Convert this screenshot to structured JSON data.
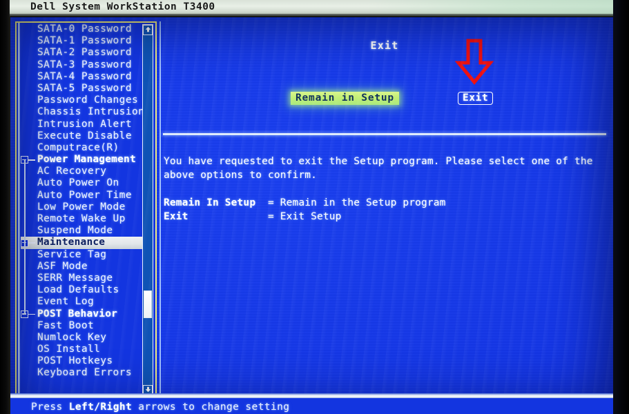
{
  "window": {
    "title": "Dell System WorkStation T3400"
  },
  "sidebar": {
    "items": [
      {
        "label": "SATA-0 Password",
        "type": "item"
      },
      {
        "label": "SATA-1 Password",
        "type": "item"
      },
      {
        "label": "SATA-2 Password",
        "type": "item"
      },
      {
        "label": "SATA-3 Password",
        "type": "item"
      },
      {
        "label": "SATA-4 Password",
        "type": "item"
      },
      {
        "label": "SATA-5 Password",
        "type": "item"
      },
      {
        "label": "Password Changes",
        "type": "item"
      },
      {
        "label": "Chassis Intrusion",
        "type": "item"
      },
      {
        "label": "Intrusion Alert",
        "type": "item"
      },
      {
        "label": "Execute Disable",
        "type": "item"
      },
      {
        "label": "Computrace(R)",
        "type": "item"
      },
      {
        "label": "Power Management",
        "type": "category"
      },
      {
        "label": "AC Recovery",
        "type": "item"
      },
      {
        "label": "Auto Power On",
        "type": "item"
      },
      {
        "label": "Auto Power Time",
        "type": "item"
      },
      {
        "label": "Low Power Mode",
        "type": "item"
      },
      {
        "label": "Remote Wake Up",
        "type": "item"
      },
      {
        "label": "Suspend Mode",
        "type": "item"
      },
      {
        "label": "Maintenance",
        "type": "category",
        "selected": true
      },
      {
        "label": "Service Tag",
        "type": "item"
      },
      {
        "label": "ASF Mode",
        "type": "item"
      },
      {
        "label": "SERR Message",
        "type": "item"
      },
      {
        "label": "Load Defaults",
        "type": "item"
      },
      {
        "label": "Event Log",
        "type": "item"
      },
      {
        "label": "POST Behavior",
        "type": "category"
      },
      {
        "label": "Fast Boot",
        "type": "item"
      },
      {
        "label": "Numlock Key",
        "type": "item"
      },
      {
        "label": "OS Install",
        "type": "item"
      },
      {
        "label": "POST Hotkeys",
        "type": "item"
      },
      {
        "label": "Keyboard Errors",
        "type": "item"
      }
    ],
    "scrollbar": {
      "up_icon": "scroll-up-arrow-icon",
      "down_icon": "scroll-down-arrow-icon"
    }
  },
  "main": {
    "title": "Exit",
    "options": {
      "remain_label": "Remain in Setup",
      "exit_label": "Exit"
    },
    "description": "You have requested to exit the Setup program. Please select one of the above options to confirm.",
    "legend": [
      {
        "term": "Remain In Setup",
        "pad": "  ",
        "sep": "= ",
        "desc": "Remain in the Setup program"
      },
      {
        "term": "Exit",
        "pad": "             ",
        "sep": "= ",
        "desc": "Exit Setup"
      }
    ],
    "annotation": {
      "shape": "red-down-arrow",
      "color": "#ee1111",
      "points_at": "Exit"
    }
  },
  "footer": {
    "prefix": "Press ",
    "keys": "Left/Right",
    "suffix": " arrows to change setting"
  },
  "colors": {
    "screen_blue": "#1335e0",
    "border_yellow": "#f2f07a",
    "highlight_green": "#c2ef74",
    "selection_white": "#e2e7ea",
    "annotation_red": "#ee1111"
  }
}
